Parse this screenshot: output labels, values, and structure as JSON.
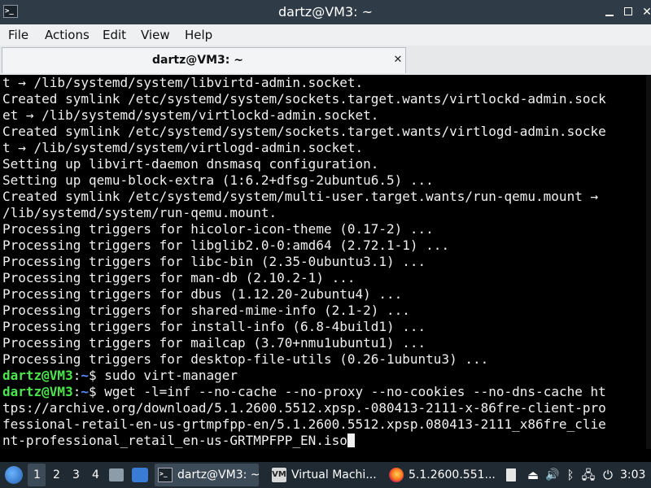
{
  "window": {
    "title": "dartz@VM3: ~",
    "app_icon_glyph": ">_",
    "minimize_glyph": "",
    "close_glyph": "✕"
  },
  "menu": [
    "File",
    "Actions",
    "Edit",
    "View",
    "Help"
  ],
  "tab": {
    "label": "dartz@VM3: ~",
    "close_glyph": "✕"
  },
  "terminal": {
    "lines": [
      "t → /lib/systemd/system/libvirtd-admin.socket.",
      "Created symlink /etc/systemd/system/sockets.target.wants/virtlockd-admin.sock",
      "et → /lib/systemd/system/virtlockd-admin.socket.",
      "Created symlink /etc/systemd/system/sockets.target.wants/virtlogd-admin.socke",
      "t → /lib/systemd/system/virtlogd-admin.socket.",
      "Setting up libvirt-daemon dnsmasq configuration.",
      "Setting up qemu-block-extra (1:6.2+dfsg-2ubuntu6.5) ...",
      "Created symlink /etc/systemd/system/multi-user.target.wants/run-qemu.mount →",
      "/lib/systemd/system/run-qemu.mount.",
      "Processing triggers for hicolor-icon-theme (0.17-2) ...",
      "Processing triggers for libglib2.0-0:amd64 (2.72.1-1) ...",
      "Processing triggers for libc-bin (2.35-0ubuntu3.1) ...",
      "Processing triggers for man-db (2.10.2-1) ...",
      "Processing triggers for dbus (1.12.20-2ubuntu4) ...",
      "Processing triggers for shared-mime-info (2.1-2) ...",
      "Processing triggers for install-info (6.8-4build1) ...",
      "Processing triggers for mailcap (3.70+nmu1ubuntu1) ...",
      "Processing triggers for desktop-file-utils (0.26-1ubuntu3) ..."
    ],
    "prompt_user": "dartz@VM3",
    "prompt_sep": ":",
    "prompt_path": "~",
    "prompt_symbol": "$ ",
    "command_1": "sudo virt-manager",
    "command_2_line_1": "wget -l=inf --no-cache --no-proxy --no-cookies --no-dns-cache ht",
    "command_2_line_2": "tps://archive.org/download/5.1.2600.5512.xpsp.-080413-2111-x-86fre-client-pro",
    "command_2_line_3": "fessional-retail-en-us-grtmpfpp-en/5.1.2600.5512.xpsp.080413-2111_x86fre_clie",
    "command_2_line_4": "nt-professional_retail_en-us-GRTMPFPP_EN.iso"
  },
  "taskbar": {
    "workspaces": [
      "1",
      "2",
      "3",
      "4"
    ],
    "active_workspace": "1",
    "tasks": [
      {
        "label": "dartz@VM3: ~",
        "icon": "terminal-icon",
        "icon_glyph": ">_"
      },
      {
        "label": "Virtual Machi...",
        "icon": "virt-manager-icon",
        "icon_glyph": "VM"
      },
      {
        "label": "5.1.2600.551...",
        "icon": "firefox-icon",
        "icon_glyph": ""
      }
    ],
    "tray": {
      "eject_glyph": "⏏",
      "volume_glyph": "🔊",
      "bluetooth_glyph": "ᛒ",
      "network_glyph": "🖧"
    },
    "clock": "3:03"
  },
  "colors": {
    "titlebar": "#2f3b46",
    "terminal_bg": "#000000",
    "prompt_user": "#4ce64c",
    "prompt_path": "#5a8cff",
    "taskbar": "#202a33"
  }
}
